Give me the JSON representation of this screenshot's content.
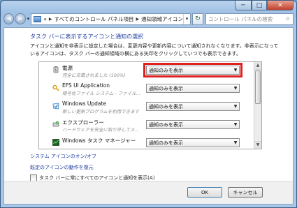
{
  "window": {
    "controls": {
      "minimize": "─",
      "maximize": "□",
      "close": "✕"
    }
  },
  "address_bar": {
    "back": "◀",
    "forward": "▶",
    "history": "▾",
    "prefix": "«",
    "breadcrumbs": [
      "すべてのコントロール パネル項目",
      "通知領域アイコン"
    ],
    "dropdown": "▾",
    "refresh": "↻",
    "search_placeholder": "コントロール パネルの検索",
    "search_icon": "⌕"
  },
  "page": {
    "title": "タスク バーに表示するアイコンと通知の選択",
    "description": "アイコンと通知を非表示に設定した場合は、変更内容や更新内容について通知されなくなります。非表示になっているアイコンは、タスク バーの通知領域の横にある矢印をクリックしていつでも表示できます。"
  },
  "icon_list": {
    "rows": [
      {
        "name": "電源",
        "subtitle": "完全に充電されました (100%)",
        "behavior": "通知のみを表示",
        "icon": "power-icon",
        "color": "#7a7a7a"
      },
      {
        "name": "EFS UI Application",
        "subtitle": "暗号化ファイル システム - ファイル...",
        "behavior": "通知のみを表示",
        "icon": "efs-icon",
        "color": "#d4a016"
      },
      {
        "name": "Windows Update",
        "subtitle": "新しい更新プログラムを利用できます",
        "behavior": "通知のみを表示",
        "icon": "windows-update-icon",
        "color": "#3a7fc9"
      },
      {
        "name": "エクスプローラー",
        "subtitle": "ハードウェアを安全に取り外してメ...",
        "behavior": "通知のみを表示",
        "icon": "explorer-icon",
        "color": "#3aa53a"
      },
      {
        "name": "Windows タスク マネージャー",
        "subtitle": "",
        "behavior": "通知のみを表示",
        "icon": "task-manager-icon",
        "color": "#2e7d32"
      }
    ],
    "highlight_color": "#e02020",
    "scroll_up": "▲",
    "scroll_down": "▼",
    "dropdown_arrow": "▼"
  },
  "links": {
    "system_icons": "システム アイコンのオン/オフ",
    "restore_defaults": "既定のアイコンの動作を復元"
  },
  "checkbox": {
    "label": "タスク バーに常にすべてのアイコンと通知を表示(A)",
    "checked": false
  },
  "buttons": {
    "ok": "OK",
    "cancel": "キャンセル"
  }
}
